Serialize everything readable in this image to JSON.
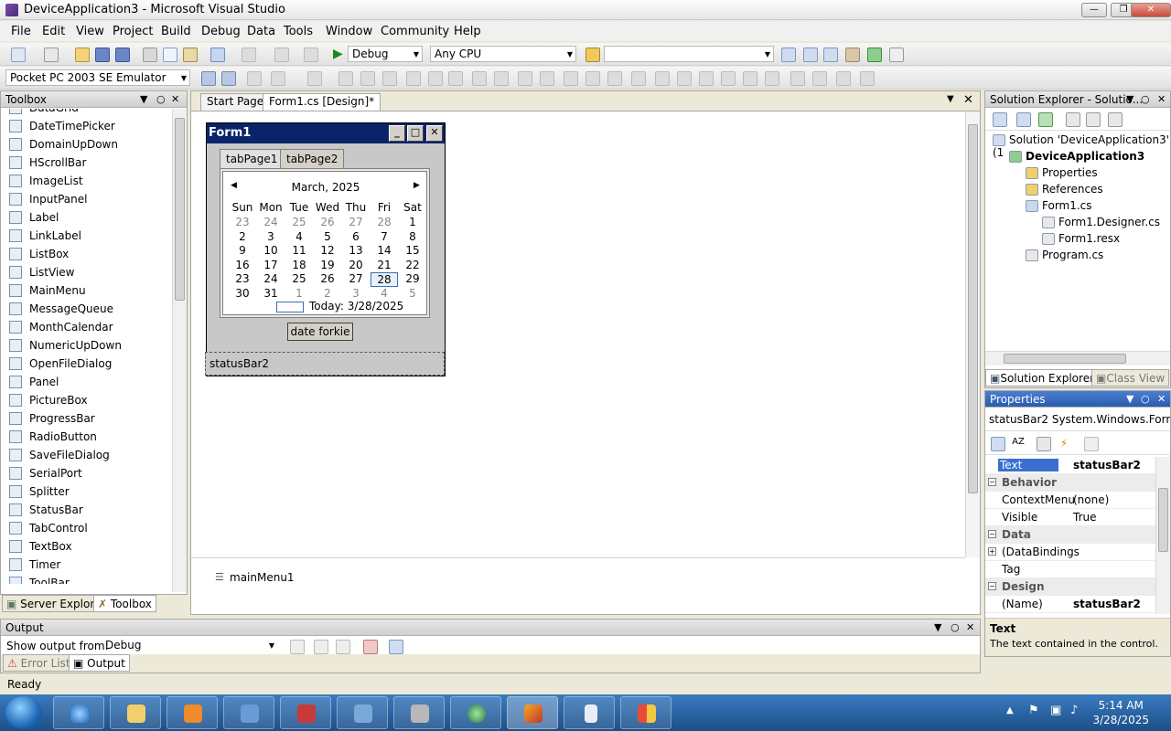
{
  "window": {
    "title": "DeviceApplication3 - Microsoft Visual Studio"
  },
  "menu": [
    "File",
    "Edit",
    "View",
    "Project",
    "Build",
    "Debug",
    "Data",
    "Tools",
    "Window",
    "Community",
    "Help"
  ],
  "toolbar": {
    "config": "Debug",
    "platform": "Any CPU",
    "device": "Pocket PC 2003 SE Emulator"
  },
  "toolbox": {
    "title": "Toolbox",
    "items": [
      {
        "label": "DataGrid",
        "icon": "grid-icon"
      },
      {
        "label": "DateTimePicker",
        "icon": "calendar-icon"
      },
      {
        "label": "DomainUpDown",
        "icon": "updown-icon"
      },
      {
        "label": "HScrollBar",
        "icon": "hscroll-icon"
      },
      {
        "label": "ImageList",
        "icon": "imagelist-icon"
      },
      {
        "label": "InputPanel",
        "icon": "keyboard-icon"
      },
      {
        "label": "Label",
        "icon": "label-icon"
      },
      {
        "label": "LinkLabel",
        "icon": "linklabel-icon"
      },
      {
        "label": "ListBox",
        "icon": "listbox-icon"
      },
      {
        "label": "ListView",
        "icon": "listview-icon"
      },
      {
        "label": "MainMenu",
        "icon": "menu-icon"
      },
      {
        "label": "MessageQueue",
        "icon": "queue-icon"
      },
      {
        "label": "MonthCalendar",
        "icon": "monthcal-icon"
      },
      {
        "label": "NumericUpDown",
        "icon": "numeric-icon"
      },
      {
        "label": "OpenFileDialog",
        "icon": "openfile-icon"
      },
      {
        "label": "Panel",
        "icon": "panel-icon"
      },
      {
        "label": "PictureBox",
        "icon": "picture-icon"
      },
      {
        "label": "ProgressBar",
        "icon": "progress-icon"
      },
      {
        "label": "RadioButton",
        "icon": "radio-icon"
      },
      {
        "label": "SaveFileDialog",
        "icon": "savefile-icon"
      },
      {
        "label": "SerialPort",
        "icon": "serialport-icon"
      },
      {
        "label": "Splitter",
        "icon": "splitter-icon"
      },
      {
        "label": "StatusBar",
        "icon": "statusbar-icon"
      },
      {
        "label": "TabControl",
        "icon": "tabcontrol-icon"
      },
      {
        "label": "TextBox",
        "icon": "textbox-icon"
      },
      {
        "label": "Timer",
        "icon": "timer-icon"
      },
      {
        "label": "ToolBar",
        "icon": "toolbar-icon"
      }
    ],
    "tabs": [
      "Server Explorer",
      "Toolbox"
    ]
  },
  "document": {
    "tabs": [
      "Start Page",
      "Form1.cs [Design]*"
    ],
    "form": {
      "title": "Form1",
      "tab_pages": [
        "tabPage1",
        "tabPage2"
      ],
      "calendar": {
        "month": "March, 2025",
        "days": [
          "Sun",
          "Mon",
          "Tue",
          "Wed",
          "Thu",
          "Fri",
          "Sat"
        ],
        "weeks": [
          [
            [
              "23",
              1
            ],
            [
              "24",
              1
            ],
            [
              "25",
              1
            ],
            [
              "26",
              1
            ],
            [
              "27",
              1
            ],
            [
              "28",
              1
            ],
            [
              "1",
              0
            ]
          ],
          [
            [
              "2",
              0
            ],
            [
              "3",
              0
            ],
            [
              "4",
              0
            ],
            [
              "5",
              0
            ],
            [
              "6",
              0
            ],
            [
              "7",
              0
            ],
            [
              "8",
              0
            ]
          ],
          [
            [
              "9",
              0
            ],
            [
              "10",
              0
            ],
            [
              "11",
              0
            ],
            [
              "12",
              0
            ],
            [
              "13",
              0
            ],
            [
              "14",
              0
            ],
            [
              "15",
              0
            ]
          ],
          [
            [
              "16",
              0
            ],
            [
              "17",
              0
            ],
            [
              "18",
              0
            ],
            [
              "19",
              0
            ],
            [
              "20",
              0
            ],
            [
              "21",
              0
            ],
            [
              "22",
              0
            ]
          ],
          [
            [
              "23",
              0
            ],
            [
              "24",
              0
            ],
            [
              "25",
              0
            ],
            [
              "26",
              0
            ],
            [
              "27",
              0
            ],
            [
              "28",
              2
            ],
            [
              "29",
              0
            ]
          ],
          [
            [
              "30",
              0
            ],
            [
              "31",
              0
            ],
            [
              "1",
              1
            ],
            [
              "2",
              1
            ],
            [
              "3",
              1
            ],
            [
              "4",
              1
            ],
            [
              "5",
              1
            ]
          ]
        ],
        "today": "Today: 3/28/2025"
      },
      "button": "date forkie",
      "statusbar": "statusBar2"
    },
    "tray_component": "mainMenu1"
  },
  "solution": {
    "title": "Solution Explorer - Solutio...",
    "items": [
      {
        "label": "Solution 'DeviceApplication3' (1",
        "indent": 0,
        "bold": false
      },
      {
        "label": "DeviceApplication3",
        "indent": 1,
        "bold": true
      },
      {
        "label": "Properties",
        "indent": 2,
        "bold": false
      },
      {
        "label": "References",
        "indent": 2,
        "bold": false
      },
      {
        "label": "Form1.cs",
        "indent": 2,
        "bold": false
      },
      {
        "label": "Form1.Designer.cs",
        "indent": 3,
        "bold": false
      },
      {
        "label": "Form1.resx",
        "indent": 3,
        "bold": false
      },
      {
        "label": "Program.cs",
        "indent": 2,
        "bold": false
      }
    ],
    "tabs": [
      "Solution Explorer",
      "Class View"
    ]
  },
  "properties": {
    "title": "Properties",
    "object": "statusBar2 System.Windows.Form",
    "rows": [
      {
        "k": "Text",
        "v": "statusBar2",
        "cat": false,
        "sel": true
      },
      {
        "k": "Behavior",
        "v": "",
        "cat": true
      },
      {
        "k": "ContextMenu",
        "v": "(none)",
        "cat": false
      },
      {
        "k": "Visible",
        "v": "True",
        "cat": false
      },
      {
        "k": "Data",
        "v": "",
        "cat": true
      },
      {
        "k": "(DataBindings",
        "v": "",
        "cat": false,
        "exp": true
      },
      {
        "k": "Tag",
        "v": "",
        "cat": false
      },
      {
        "k": "Design",
        "v": "",
        "cat": true
      },
      {
        "k": "(Name)",
        "v": "statusBar2",
        "cat": false
      }
    ],
    "desc_title": "Text",
    "desc_text": "The text contained in the control."
  },
  "output": {
    "title": "Output",
    "show_from_label": "Show output from:",
    "show_from_value": "Debug",
    "tabs": [
      "Error List",
      "Output"
    ]
  },
  "status": "Ready",
  "clock": {
    "time": "5:14 AM",
    "date": "3/28/2025"
  }
}
